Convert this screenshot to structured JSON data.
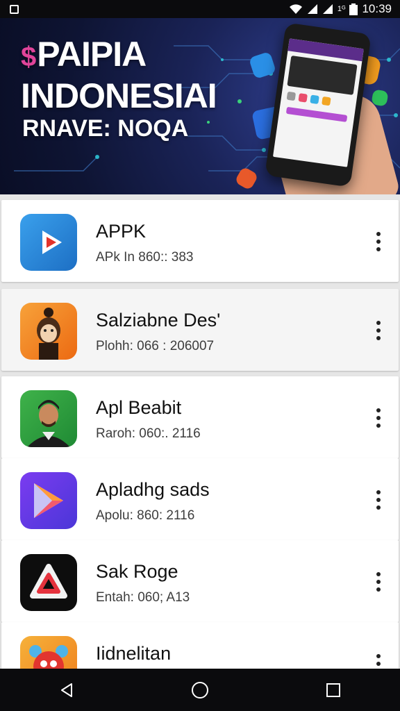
{
  "status_bar": {
    "time": "10:39",
    "carrier_small": "1ᴳ",
    "icons": [
      "notification-square-icon",
      "wifi-icon",
      "signal-icon",
      "signal-icon",
      "battery-icon"
    ]
  },
  "banner": {
    "title_symbol": "$",
    "title_line1": "PAIPIA",
    "title_line2": "INDONESIAI",
    "subtitle": "RNAVE: NOQA",
    "colors": {
      "background": "#131a45",
      "accent": "#e0449a"
    }
  },
  "apps": [
    {
      "name": "APPK",
      "meta": "APk In 860:: 383",
      "icon": "play-icon",
      "icon_bg": "#2f86d9"
    },
    {
      "name": "Salziabne Des'",
      "meta": "Plohh: 066 : 206007",
      "icon": "monkey-icon",
      "icon_bg": "#f07f1c"
    },
    {
      "name": "Apl Beabit",
      "meta": "Raroh: 060:. 2116",
      "icon": "man-avatar-icon",
      "icon_bg": "#2f9b3c"
    },
    {
      "name": "Apladhg sads",
      "meta": "Apolu: 860: 2116",
      "icon": "play-store-icon",
      "icon_bg": "#6a3ae0"
    },
    {
      "name": "Sak Roge",
      "meta": "Entah: 060; A13",
      "icon": "warning-triangle-icon",
      "icon_bg": "#0d0d0d"
    },
    {
      "name": "Iidnelitan",
      "meta": "",
      "icon": "cartoon-face-icon",
      "icon_bg": "#f09a25"
    }
  ],
  "nav_bar": {
    "items": [
      "back-icon",
      "home-icon",
      "recents-icon"
    ]
  }
}
